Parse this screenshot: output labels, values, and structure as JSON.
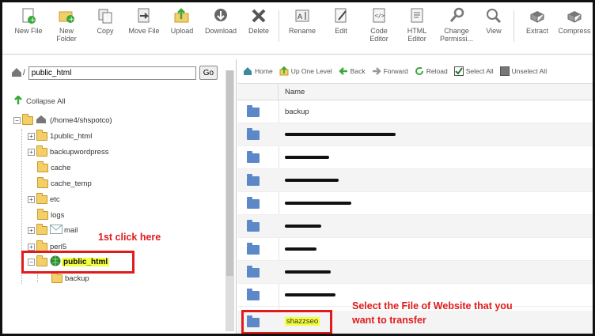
{
  "toolbar": {
    "buttons": [
      {
        "label": "New File",
        "icon": "new-file-icon"
      },
      {
        "label": "New\nFolder",
        "icon": "new-folder-icon"
      },
      {
        "label": "Copy",
        "icon": "copy-icon"
      },
      {
        "label": "Move File",
        "icon": "move-file-icon"
      },
      {
        "label": "Upload",
        "icon": "upload-icon"
      },
      {
        "label": "Download",
        "icon": "download-icon"
      },
      {
        "label": "Delete",
        "icon": "delete-icon"
      },
      {
        "label": "Rename",
        "icon": "rename-icon"
      },
      {
        "label": "Edit",
        "icon": "edit-icon"
      },
      {
        "label": "Code\nEditor",
        "icon": "code-editor-icon"
      },
      {
        "label": "HTML\nEditor",
        "icon": "html-editor-icon"
      },
      {
        "label": "Change\nPermissi...",
        "icon": "permissions-icon"
      },
      {
        "label": "View",
        "icon": "view-icon"
      },
      {
        "label": "Extract",
        "icon": "extract-icon"
      },
      {
        "label": "Compress",
        "icon": "compress-icon"
      }
    ]
  },
  "left": {
    "path_value": "public_html",
    "go_label": "Go",
    "collapse_label": "Collapse All",
    "root_label": "(/home4/shspotco)",
    "tree": [
      {
        "label": "1public_html"
      },
      {
        "label": "backupwordpress"
      },
      {
        "label": "cache"
      },
      {
        "label": "cache_temp"
      },
      {
        "label": "etc"
      },
      {
        "label": "logs"
      },
      {
        "label": "mail"
      },
      {
        "label": "perl5"
      },
      {
        "label": "public_html"
      },
      {
        "label": "backup"
      }
    ]
  },
  "right": {
    "toolbar": [
      {
        "label": "Home",
        "icon": "home-icon"
      },
      {
        "label": "Up One Level",
        "icon": "up-level-icon"
      },
      {
        "label": "Back",
        "icon": "back-arrow-icon"
      },
      {
        "label": "Forward",
        "icon": "forward-arrow-icon"
      },
      {
        "label": "Reload",
        "icon": "reload-icon"
      },
      {
        "label": "Select All",
        "icon": "checkbox-checked-icon"
      },
      {
        "label": "Unselect All",
        "icon": "checkbox-empty-icon"
      }
    ],
    "column_name": "Name",
    "rows": [
      {
        "label": "backup"
      },
      {
        "label": "shazzseo"
      }
    ]
  },
  "annotations": {
    "click_here": "1st click here",
    "select_line1": "Select the File of Website that you",
    "select_line2": "want to transfer"
  },
  "colors": {
    "annotation_red": "#e01b1b",
    "highlight_yellow": "#f0ff3a",
    "folder_blue": "#5c88c8",
    "folder_yellow": "#f3cf6a"
  }
}
